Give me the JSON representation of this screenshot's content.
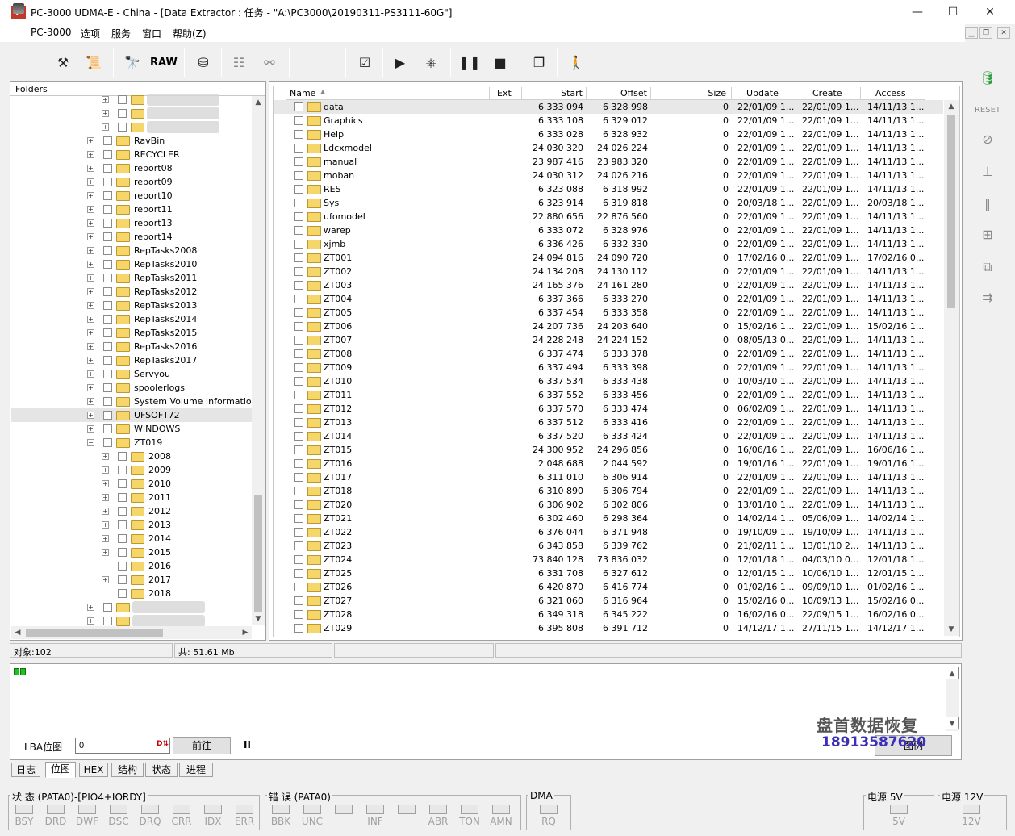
{
  "window": {
    "app_icon_text": "P",
    "title": "PC-3000 UDMA-E - China - [Data Extractor : 任务 - \"A:\\PC3000\\20190311-PS3111-60G\"]",
    "minimize": "—",
    "maximize": "☐",
    "close": "✕"
  },
  "menu": {
    "items": [
      "PC-3000",
      "选项",
      "服务",
      "窗口",
      "帮助(Z)"
    ],
    "mdi": [
      "▁",
      "❐",
      "✕"
    ]
  },
  "toolbar": {
    "raw_label": "RAW"
  },
  "folders": {
    "header": "Folders",
    "nodes": [
      {
        "label": "",
        "expander": "+",
        "indent": 2,
        "blurred": true
      },
      {
        "label": "",
        "expander": "+",
        "indent": 2,
        "blurred": true
      },
      {
        "label": "",
        "expander": "+",
        "indent": 2,
        "blurred": true
      },
      {
        "label": "RavBin",
        "expander": "+",
        "indent": 1
      },
      {
        "label": "RECYCLER",
        "expander": "+",
        "indent": 1
      },
      {
        "label": "report08",
        "expander": "+",
        "indent": 1
      },
      {
        "label": "report09",
        "expander": "+",
        "indent": 1
      },
      {
        "label": "report10",
        "expander": "+",
        "indent": 1
      },
      {
        "label": "report11",
        "expander": "+",
        "indent": 1
      },
      {
        "label": "report13",
        "expander": "+",
        "indent": 1
      },
      {
        "label": "report14",
        "expander": "+",
        "indent": 1
      },
      {
        "label": "RepTasks2008",
        "expander": "+",
        "indent": 1
      },
      {
        "label": "RepTasks2010",
        "expander": "+",
        "indent": 1
      },
      {
        "label": "RepTasks2011",
        "expander": "+",
        "indent": 1
      },
      {
        "label": "RepTasks2012",
        "expander": "+",
        "indent": 1
      },
      {
        "label": "RepTasks2013",
        "expander": "+",
        "indent": 1
      },
      {
        "label": "RepTasks2014",
        "expander": "+",
        "indent": 1
      },
      {
        "label": "RepTasks2015",
        "expander": "+",
        "indent": 1
      },
      {
        "label": "RepTasks2016",
        "expander": "+",
        "indent": 1
      },
      {
        "label": "RepTasks2017",
        "expander": "+",
        "indent": 1
      },
      {
        "label": "Servyou",
        "expander": "+",
        "indent": 1
      },
      {
        "label": "spoolerlogs",
        "expander": "+",
        "indent": 1
      },
      {
        "label": "System Volume Information",
        "expander": "+",
        "indent": 1
      },
      {
        "label": "UFSOFT72",
        "expander": "+",
        "indent": 1,
        "selected": true
      },
      {
        "label": "WINDOWS",
        "expander": "+",
        "indent": 1
      },
      {
        "label": "ZT019",
        "expander": "−",
        "indent": 1
      },
      {
        "label": "2008",
        "expander": "+",
        "indent": 2
      },
      {
        "label": "2009",
        "expander": "+",
        "indent": 2
      },
      {
        "label": "2010",
        "expander": "+",
        "indent": 2
      },
      {
        "label": "2011",
        "expander": "+",
        "indent": 2
      },
      {
        "label": "2012",
        "expander": "+",
        "indent": 2
      },
      {
        "label": "2013",
        "expander": "+",
        "indent": 2
      },
      {
        "label": "2014",
        "expander": "+",
        "indent": 2
      },
      {
        "label": "2015",
        "expander": "+",
        "indent": 2
      },
      {
        "label": "2016",
        "expander": "",
        "indent": 2
      },
      {
        "label": "2017",
        "expander": "+",
        "indent": 2
      },
      {
        "label": "2018",
        "expander": "",
        "indent": 2
      },
      {
        "label": "",
        "expander": "+",
        "indent": 1,
        "blurred": true
      },
      {
        "label": "",
        "expander": "+",
        "indent": 1,
        "blurred": true
      }
    ]
  },
  "filelist": {
    "columns": [
      "Name",
      "Ext",
      "Start",
      "Offset",
      "Size",
      "Update",
      "Create",
      "Access"
    ],
    "rows": [
      [
        "data",
        "",
        "6 333 094",
        "6 328 998",
        "0",
        "22/01/09 1...",
        "22/01/09 1...",
        "14/11/13 1..."
      ],
      [
        "Graphics",
        "",
        "6 333 108",
        "6 329 012",
        "0",
        "22/01/09 1...",
        "22/01/09 1...",
        "14/11/13 1..."
      ],
      [
        "Help",
        "",
        "6 333 028",
        "6 328 932",
        "0",
        "22/01/09 1...",
        "22/01/09 1...",
        "14/11/13 1..."
      ],
      [
        "Ldcxmodel",
        "",
        "24 030 320",
        "24 026 224",
        "0",
        "22/01/09 1...",
        "22/01/09 1...",
        "14/11/13 1..."
      ],
      [
        "manual",
        "",
        "23 987 416",
        "23 983 320",
        "0",
        "22/01/09 1...",
        "22/01/09 1...",
        "14/11/13 1..."
      ],
      [
        "moban",
        "",
        "24 030 312",
        "24 026 216",
        "0",
        "22/01/09 1...",
        "22/01/09 1...",
        "14/11/13 1..."
      ],
      [
        "RES",
        "",
        "6 323 088",
        "6 318 992",
        "0",
        "22/01/09 1...",
        "22/01/09 1...",
        "14/11/13 1..."
      ],
      [
        "Sys",
        "",
        "6 323 914",
        "6 319 818",
        "0",
        "20/03/18 1...",
        "22/01/09 1...",
        "20/03/18 1..."
      ],
      [
        "ufomodel",
        "",
        "22 880 656",
        "22 876 560",
        "0",
        "22/01/09 1...",
        "22/01/09 1...",
        "14/11/13 1..."
      ],
      [
        "warep",
        "",
        "6 333 072",
        "6 328 976",
        "0",
        "22/01/09 1...",
        "22/01/09 1...",
        "14/11/13 1..."
      ],
      [
        "xjmb",
        "",
        "6 336 426",
        "6 332 330",
        "0",
        "22/01/09 1...",
        "22/01/09 1...",
        "14/11/13 1..."
      ],
      [
        "ZT001",
        "",
        "24 094 816",
        "24 090 720",
        "0",
        "17/02/16 0...",
        "22/01/09 1...",
        "17/02/16 0..."
      ],
      [
        "ZT002",
        "",
        "24 134 208",
        "24 130 112",
        "0",
        "22/01/09 1...",
        "22/01/09 1...",
        "14/11/13 1..."
      ],
      [
        "ZT003",
        "",
        "24 165 376",
        "24 161 280",
        "0",
        "22/01/09 1...",
        "22/01/09 1...",
        "14/11/13 1..."
      ],
      [
        "ZT004",
        "",
        "6 337 366",
        "6 333 270",
        "0",
        "22/01/09 1...",
        "22/01/09 1...",
        "14/11/13 1..."
      ],
      [
        "ZT005",
        "",
        "6 337 454",
        "6 333 358",
        "0",
        "22/01/09 1...",
        "22/01/09 1...",
        "14/11/13 1..."
      ],
      [
        "ZT006",
        "",
        "24 207 736",
        "24 203 640",
        "0",
        "15/02/16 1...",
        "22/01/09 1...",
        "15/02/16 1..."
      ],
      [
        "ZT007",
        "",
        "24 228 248",
        "24 224 152",
        "0",
        "08/05/13 0...",
        "22/01/09 1...",
        "14/11/13 1..."
      ],
      [
        "ZT008",
        "",
        "6 337 474",
        "6 333 378",
        "0",
        "22/01/09 1...",
        "22/01/09 1...",
        "14/11/13 1..."
      ],
      [
        "ZT009",
        "",
        "6 337 494",
        "6 333 398",
        "0",
        "22/01/09 1...",
        "22/01/09 1...",
        "14/11/13 1..."
      ],
      [
        "ZT010",
        "",
        "6 337 534",
        "6 333 438",
        "0",
        "10/03/10 1...",
        "22/01/09 1...",
        "14/11/13 1..."
      ],
      [
        "ZT011",
        "",
        "6 337 552",
        "6 333 456",
        "0",
        "22/01/09 1...",
        "22/01/09 1...",
        "14/11/13 1..."
      ],
      [
        "ZT012",
        "",
        "6 337 570",
        "6 333 474",
        "0",
        "06/02/09 1...",
        "22/01/09 1...",
        "14/11/13 1..."
      ],
      [
        "ZT013",
        "",
        "6 337 512",
        "6 333 416",
        "0",
        "22/01/09 1...",
        "22/01/09 1...",
        "14/11/13 1..."
      ],
      [
        "ZT014",
        "",
        "6 337 520",
        "6 333 424",
        "0",
        "22/01/09 1...",
        "22/01/09 1...",
        "14/11/13 1..."
      ],
      [
        "ZT015",
        "",
        "24 300 952",
        "24 296 856",
        "0",
        "16/06/16 1...",
        "22/01/09 1...",
        "16/06/16 1..."
      ],
      [
        "ZT016",
        "",
        "2 048 688",
        "2 044 592",
        "0",
        "19/01/16 1...",
        "22/01/09 1...",
        "19/01/16 1..."
      ],
      [
        "ZT017",
        "",
        "6 311 010",
        "6 306 914",
        "0",
        "22/01/09 1...",
        "22/01/09 1...",
        "14/11/13 1..."
      ],
      [
        "ZT018",
        "",
        "6 310 890",
        "6 306 794",
        "0",
        "22/01/09 1...",
        "22/01/09 1...",
        "14/11/13 1..."
      ],
      [
        "ZT020",
        "",
        "6 306 902",
        "6 302 806",
        "0",
        "13/01/10 1...",
        "22/01/09 1...",
        "14/11/13 1..."
      ],
      [
        "ZT021",
        "",
        "6 302 460",
        "6 298 364",
        "0",
        "14/02/14 1...",
        "05/06/09 1...",
        "14/02/14 1..."
      ],
      [
        "ZT022",
        "",
        "6 376 044",
        "6 371 948",
        "0",
        "19/10/09 1...",
        "19/10/09 1...",
        "14/11/13 1..."
      ],
      [
        "ZT023",
        "",
        "6 343 858",
        "6 339 762",
        "0",
        "21/02/11 1...",
        "13/01/10 2...",
        "14/11/13 1..."
      ],
      [
        "ZT024",
        "",
        "73 840 128",
        "73 836 032",
        "0",
        "12/01/18 1...",
        "04/03/10 0...",
        "12/01/18 1..."
      ],
      [
        "ZT025",
        "",
        "6 331 708",
        "6 327 612",
        "0",
        "12/01/15 1...",
        "10/06/10 1...",
        "12/01/15 1..."
      ],
      [
        "ZT026",
        "",
        "6 420 870",
        "6 416 774",
        "0",
        "01/02/16 1...",
        "09/09/10 1...",
        "01/02/16 1..."
      ],
      [
        "ZT027",
        "",
        "6 321 060",
        "6 316 964",
        "0",
        "15/02/16 0...",
        "10/09/13 1...",
        "15/02/16 0..."
      ],
      [
        "ZT028",
        "",
        "6 349 318",
        "6 345 222",
        "0",
        "16/02/16 0...",
        "22/09/15 1...",
        "16/02/16 0..."
      ],
      [
        "ZT029",
        "",
        "6 395 808",
        "6 391 712",
        "0",
        "14/12/17 1...",
        "27/11/15 1...",
        "14/12/17 1..."
      ]
    ]
  },
  "status": {
    "objects": "对象:102",
    "total": "共: 51.61 Mb"
  },
  "log": {
    "lba_label": "LBA位图",
    "lba_value": "0",
    "lba_btn_icon": "D⇅",
    "goto_button": "前往",
    "pause_glyph": "II",
    "view_button": "图例"
  },
  "watermark": {
    "line1": "盘首数据恢复",
    "line2": "18913587620"
  },
  "tabs": [
    "日志",
    "位图",
    "HEX",
    "结构",
    "状态",
    "进程"
  ],
  "indicators": {
    "status_title": "状 态 (PATA0)-[PIO4+IORDY]",
    "status_leds": [
      "BSY",
      "DRD",
      "DWF",
      "DSC",
      "DRQ",
      "CRR",
      "IDX",
      "ERR"
    ],
    "error_title": "错 误 (PATA0)",
    "error_leds": [
      "BBK",
      "UNC",
      "",
      "INF",
      "",
      "ABR",
      "TON",
      "AMN"
    ],
    "dma_title": "DMA",
    "dma_leds": [
      "RQ"
    ],
    "p5_title": "电源 5V",
    "p5_leds": [
      "5V"
    ],
    "p12_title": "电源 12V",
    "p12_leds": [
      "12V"
    ]
  }
}
